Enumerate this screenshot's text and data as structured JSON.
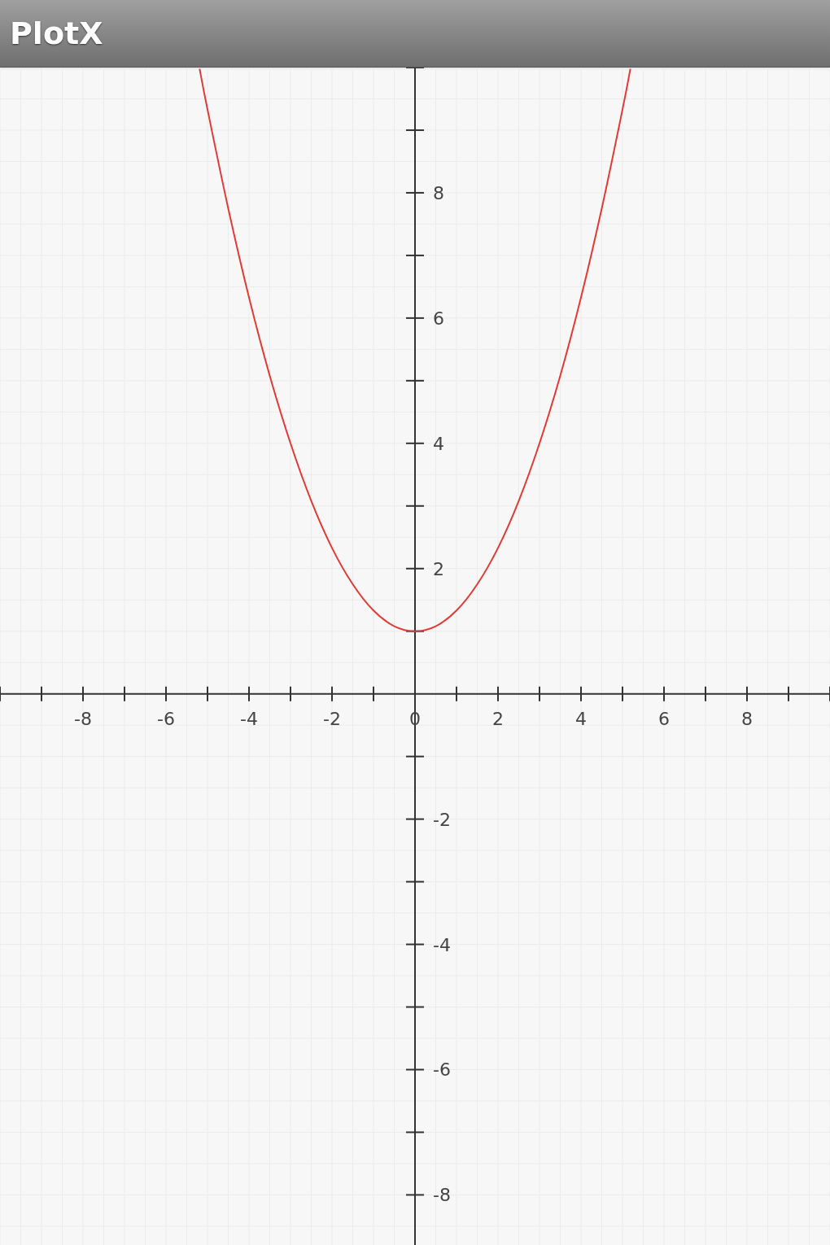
{
  "app_bar": {
    "title": "PlotX"
  },
  "plot": {
    "chart_data": {
      "type": "line",
      "grid": true,
      "x": [
        -5.19,
        -5,
        -4.5,
        -4,
        -3.5,
        -3,
        -2.5,
        -2,
        -1.5,
        -1,
        -0.5,
        0,
        0.5,
        1,
        1.5,
        2,
        2.5,
        3,
        3.5,
        4,
        4.5,
        5,
        5.19
      ],
      "series": [
        {
          "color": "#e53935",
          "values": [
            9.98,
            9.33,
            7.75,
            6.33,
            5.08,
            4,
            3.08,
            2.33,
            1.75,
            1.33,
            1.08,
            1,
            1.08,
            1.33,
            1.75,
            2.33,
            3.08,
            4,
            5.08,
            6.33,
            7.75,
            9.33,
            9.98
          ]
        }
      ],
      "xlim": [
        -10,
        10
      ],
      "ylim": [
        -8.8,
        10
      ],
      "xticks": [
        {
          "value": -8,
          "label": "-8"
        },
        {
          "value": -6,
          "label": "-6"
        },
        {
          "value": -4,
          "label": "-4"
        },
        {
          "value": -2,
          "label": "-2"
        },
        {
          "value": 0,
          "label": "0"
        },
        {
          "value": 2,
          "label": "2"
        },
        {
          "value": 4,
          "label": "4"
        },
        {
          "value": 6,
          "label": "6"
        },
        {
          "value": 8,
          "label": "8"
        }
      ],
      "yticks": [
        {
          "value": 8,
          "label": "8"
        },
        {
          "value": 6,
          "label": "6"
        },
        {
          "value": 4,
          "label": "4"
        },
        {
          "value": 2,
          "label": "2"
        },
        {
          "value": -2,
          "label": "-2"
        },
        {
          "value": -4,
          "label": "-4"
        },
        {
          "value": -6,
          "label": "-6"
        },
        {
          "value": -8,
          "label": "-8"
        }
      ]
    }
  }
}
